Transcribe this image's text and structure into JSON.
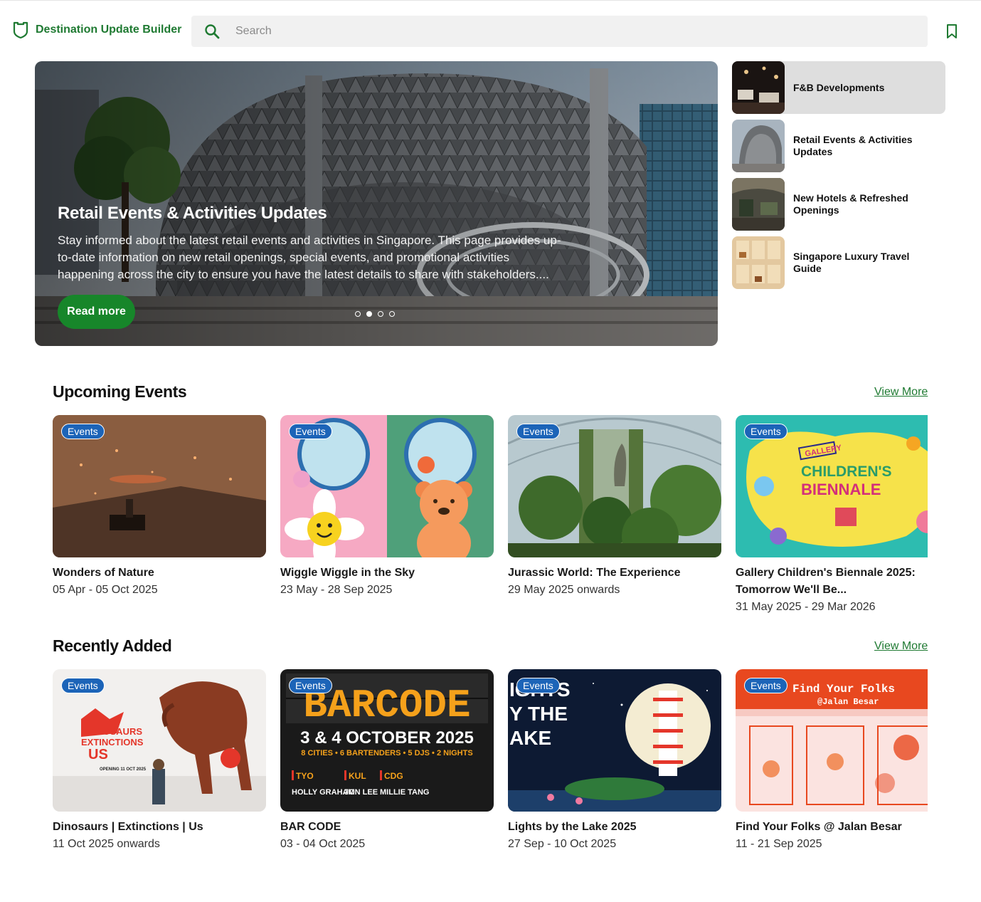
{
  "header": {
    "brand_title": "Destination Update Builder",
    "search_placeholder": "Search"
  },
  "hero": {
    "title": "Retail Events & Activities Updates",
    "description": "Stay informed about the latest retail events and activities in Singapore. This page provides up-to-date information on new retail openings, special events, and promotional activities happening across the city to ensure you have the latest details to share with stakeholders....",
    "button_label": "Read more",
    "dots_count": 4,
    "active_dot": 2
  },
  "side_list": [
    {
      "label": "F&B Developments",
      "active": true
    },
    {
      "label": "Retail Events & Activities Updates",
      "active": false
    },
    {
      "label": "New Hotels & Refreshed Openings",
      "active": false
    },
    {
      "label": "Singapore Luxury Travel Guide",
      "active": false
    }
  ],
  "upcoming": {
    "title": "Upcoming Events",
    "view_more": "View More",
    "cards": [
      {
        "badge": "Events",
        "title": "Wonders of Nature",
        "date": "05 Apr - 05 Oct 2025"
      },
      {
        "badge": "Events",
        "title": "Wiggle Wiggle in the Sky",
        "date": "23 May - 28 Sep 2025"
      },
      {
        "badge": "Events",
        "title": "Jurassic World: The Experience",
        "date": "29 May 2025 onwards"
      },
      {
        "badge": "Events",
        "title": "Gallery Children's Biennale 2025: Tomorrow We'll Be...",
        "date": "31 May 2025 - 29 Mar 2026"
      }
    ]
  },
  "recent": {
    "title": "Recently Added",
    "view_more": "View More",
    "cards": [
      {
        "badge": "Events",
        "title": "Dinosaurs | Extinctions | Us",
        "date": "11 Oct 2025 onwards"
      },
      {
        "badge": "Events",
        "title": "BAR CODE",
        "date": "03 - 04 Oct 2025"
      },
      {
        "badge": "Events",
        "title": "Lights by the Lake 2025",
        "date": "27 Sep - 10 Oct 2025"
      },
      {
        "badge": "Events",
        "title": "Find Your Folks @ Jalan Besar",
        "date": "11 - 21 Sep 2025"
      }
    ]
  },
  "image_text": {
    "biennale_line1": "GALLERY",
    "biennale_line2": "CHILDREN'S",
    "biennale_line3": "BIENNALE",
    "dino_line1": "DINOSAURS",
    "dino_line2": "EXTINCTIONS",
    "dino_line3": "US",
    "dino_opening": "OPENING 11 OCT 2025",
    "barcode_word": "BARCODE",
    "barcode_dates": "3 & 4 OCTOBER 2025",
    "barcode_sub": "8 CITIES • 6 BARTENDERS • 5 DJS • 2 NIGHTS",
    "barcode_city1": "TYO",
    "barcode_city2": "KUL",
    "barcode_city3": "CDG",
    "barcode_name1": "HOLLY GRAHAM",
    "barcode_name2": "JON LEE",
    "barcode_name3": "MILLIE TANG",
    "lake_line1": "IGHTS",
    "lake_line2": "Y THE",
    "lake_line3": "AKE",
    "folks_line1": "Find Your Folks",
    "folks_line2": "@Jalan Besar"
  },
  "colors": {
    "brand_green": "#1f7a32",
    "button_green": "#17862a",
    "badge_blue": "#1c64b8",
    "search_bg": "#f1f1f1",
    "active_side_bg": "#dedede"
  }
}
